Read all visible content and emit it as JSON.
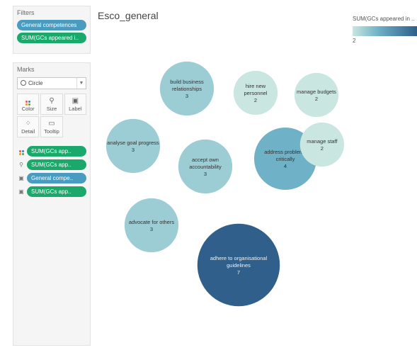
{
  "filters": {
    "title": "Filters",
    "items": [
      "General competences",
      "SUM(GCs appeared i.."
    ]
  },
  "marks": {
    "title": "Marks",
    "mark_type": "Circle",
    "buttons": [
      "Color",
      "Size",
      "Label",
      "Detail",
      "Tooltip"
    ],
    "shelves": [
      {
        "icon": "color-dots-icon",
        "label": "SUM(GCs app.."
      },
      {
        "icon": "size-icon",
        "label": "SUM(GCs app.."
      },
      {
        "icon": "label-icon",
        "label": "General compe.."
      },
      {
        "icon": "label-icon",
        "label": "SUM(GCs app.."
      }
    ]
  },
  "sheet": {
    "title": "Esco_general"
  },
  "legend": {
    "title": "SUM(GCs appeared in ..",
    "min_label": "2",
    "colors": [
      "#c9e6e1",
      "#6fb1c6",
      "#2f5f8a"
    ]
  },
  "chart_data": {
    "type": "bubble",
    "measure": "SUM(GCs appeared in ..",
    "bubbles": [
      {
        "label": "build business relationships",
        "value": 3
      },
      {
        "label": "hire new personnel",
        "value": 2
      },
      {
        "label": "manage budgets",
        "value": 2
      },
      {
        "label": "analyse goal progress",
        "value": 3
      },
      {
        "label": "accept own accountability",
        "value": 3
      },
      {
        "label": "address problems critically",
        "value": 4
      },
      {
        "label": "manage staff",
        "value": 2
      },
      {
        "label": "advocate for others",
        "value": 3
      },
      {
        "label": "adhere to organisational guidelines",
        "value": 7
      }
    ]
  }
}
